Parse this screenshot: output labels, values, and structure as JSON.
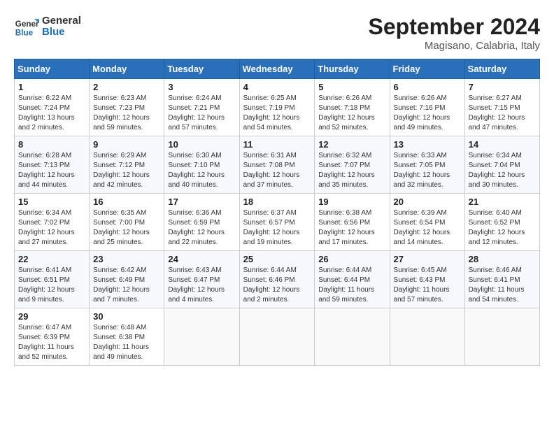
{
  "header": {
    "logo_line1": "General",
    "logo_line2": "Blue",
    "month": "September 2024",
    "location": "Magisano, Calabria, Italy"
  },
  "days_of_week": [
    "Sunday",
    "Monday",
    "Tuesday",
    "Wednesday",
    "Thursday",
    "Friday",
    "Saturday"
  ],
  "weeks": [
    [
      {
        "day": "1",
        "info": "Sunrise: 6:22 AM\nSunset: 7:24 PM\nDaylight: 13 hours\nand 2 minutes."
      },
      {
        "day": "2",
        "info": "Sunrise: 6:23 AM\nSunset: 7:23 PM\nDaylight: 12 hours\nand 59 minutes."
      },
      {
        "day": "3",
        "info": "Sunrise: 6:24 AM\nSunset: 7:21 PM\nDaylight: 12 hours\nand 57 minutes."
      },
      {
        "day": "4",
        "info": "Sunrise: 6:25 AM\nSunset: 7:19 PM\nDaylight: 12 hours\nand 54 minutes."
      },
      {
        "day": "5",
        "info": "Sunrise: 6:26 AM\nSunset: 7:18 PM\nDaylight: 12 hours\nand 52 minutes."
      },
      {
        "day": "6",
        "info": "Sunrise: 6:26 AM\nSunset: 7:16 PM\nDaylight: 12 hours\nand 49 minutes."
      },
      {
        "day": "7",
        "info": "Sunrise: 6:27 AM\nSunset: 7:15 PM\nDaylight: 12 hours\nand 47 minutes."
      }
    ],
    [
      {
        "day": "8",
        "info": "Sunrise: 6:28 AM\nSunset: 7:13 PM\nDaylight: 12 hours\nand 44 minutes."
      },
      {
        "day": "9",
        "info": "Sunrise: 6:29 AM\nSunset: 7:12 PM\nDaylight: 12 hours\nand 42 minutes."
      },
      {
        "day": "10",
        "info": "Sunrise: 6:30 AM\nSunset: 7:10 PM\nDaylight: 12 hours\nand 40 minutes."
      },
      {
        "day": "11",
        "info": "Sunrise: 6:31 AM\nSunset: 7:08 PM\nDaylight: 12 hours\nand 37 minutes."
      },
      {
        "day": "12",
        "info": "Sunrise: 6:32 AM\nSunset: 7:07 PM\nDaylight: 12 hours\nand 35 minutes."
      },
      {
        "day": "13",
        "info": "Sunrise: 6:33 AM\nSunset: 7:05 PM\nDaylight: 12 hours\nand 32 minutes."
      },
      {
        "day": "14",
        "info": "Sunrise: 6:34 AM\nSunset: 7:04 PM\nDaylight: 12 hours\nand 30 minutes."
      }
    ],
    [
      {
        "day": "15",
        "info": "Sunrise: 6:34 AM\nSunset: 7:02 PM\nDaylight: 12 hours\nand 27 minutes."
      },
      {
        "day": "16",
        "info": "Sunrise: 6:35 AM\nSunset: 7:00 PM\nDaylight: 12 hours\nand 25 minutes."
      },
      {
        "day": "17",
        "info": "Sunrise: 6:36 AM\nSunset: 6:59 PM\nDaylight: 12 hours\nand 22 minutes."
      },
      {
        "day": "18",
        "info": "Sunrise: 6:37 AM\nSunset: 6:57 PM\nDaylight: 12 hours\nand 19 minutes."
      },
      {
        "day": "19",
        "info": "Sunrise: 6:38 AM\nSunset: 6:56 PM\nDaylight: 12 hours\nand 17 minutes."
      },
      {
        "day": "20",
        "info": "Sunrise: 6:39 AM\nSunset: 6:54 PM\nDaylight: 12 hours\nand 14 minutes."
      },
      {
        "day": "21",
        "info": "Sunrise: 6:40 AM\nSunset: 6:52 PM\nDaylight: 12 hours\nand 12 minutes."
      }
    ],
    [
      {
        "day": "22",
        "info": "Sunrise: 6:41 AM\nSunset: 6:51 PM\nDaylight: 12 hours\nand 9 minutes."
      },
      {
        "day": "23",
        "info": "Sunrise: 6:42 AM\nSunset: 6:49 PM\nDaylight: 12 hours\nand 7 minutes."
      },
      {
        "day": "24",
        "info": "Sunrise: 6:43 AM\nSunset: 6:47 PM\nDaylight: 12 hours\nand 4 minutes."
      },
      {
        "day": "25",
        "info": "Sunrise: 6:44 AM\nSunset: 6:46 PM\nDaylight: 12 hours\nand 2 minutes."
      },
      {
        "day": "26",
        "info": "Sunrise: 6:44 AM\nSunset: 6:44 PM\nDaylight: 11 hours\nand 59 minutes."
      },
      {
        "day": "27",
        "info": "Sunrise: 6:45 AM\nSunset: 6:43 PM\nDaylight: 11 hours\nand 57 minutes."
      },
      {
        "day": "28",
        "info": "Sunrise: 6:46 AM\nSunset: 6:41 PM\nDaylight: 11 hours\nand 54 minutes."
      }
    ],
    [
      {
        "day": "29",
        "info": "Sunrise: 6:47 AM\nSunset: 6:39 PM\nDaylight: 11 hours\nand 52 minutes."
      },
      {
        "day": "30",
        "info": "Sunrise: 6:48 AM\nSunset: 6:38 PM\nDaylight: 11 hours\nand 49 minutes."
      },
      null,
      null,
      null,
      null,
      null
    ]
  ]
}
